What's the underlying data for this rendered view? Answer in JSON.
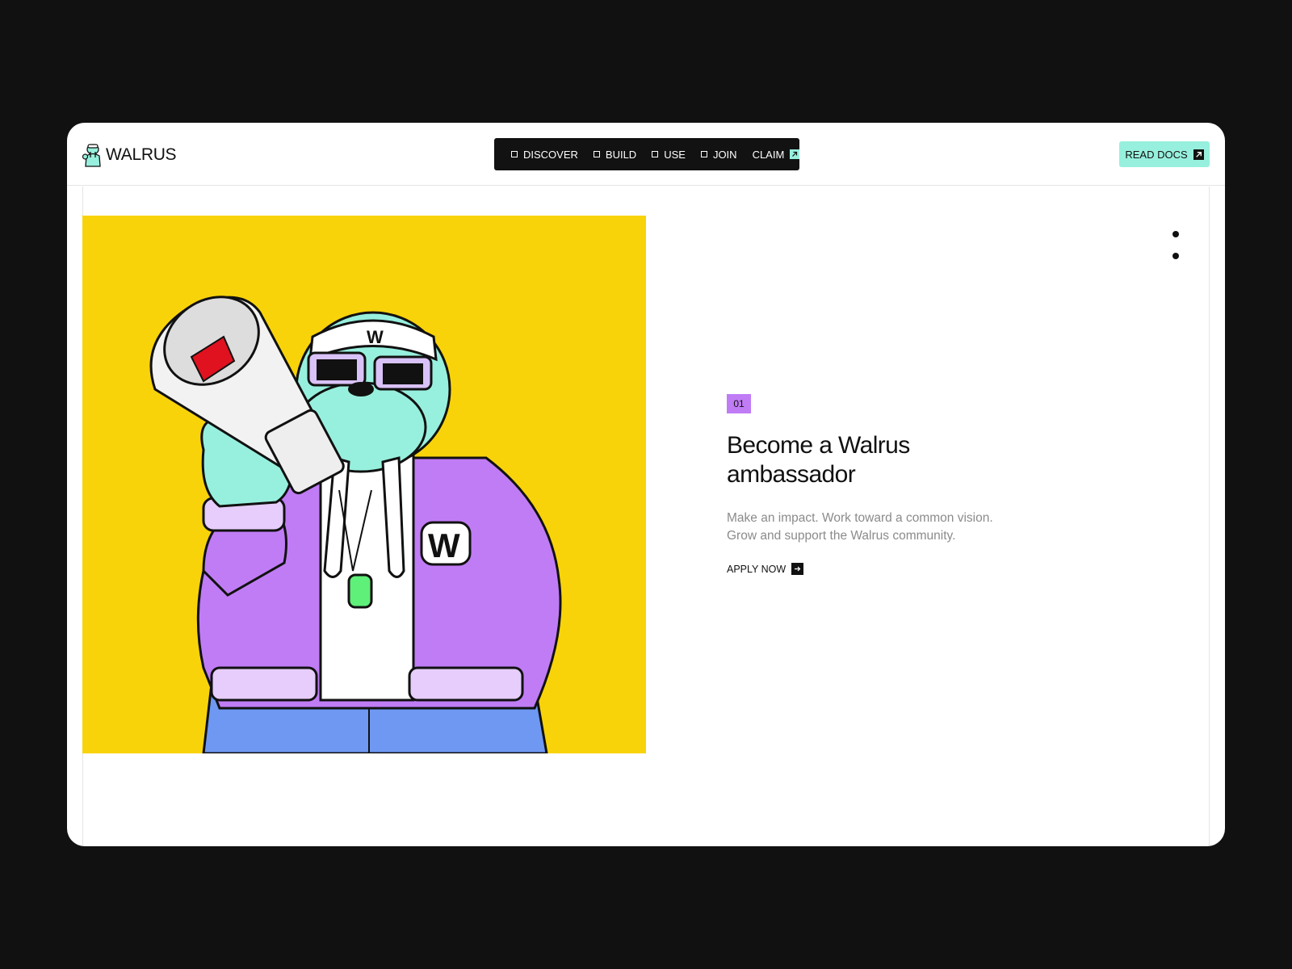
{
  "header": {
    "logo_text": "WALRUS",
    "logo_icon": "walrus-mascot-icon"
  },
  "nav": {
    "items": [
      {
        "label": "DISCOVER",
        "icon": "square-icon"
      },
      {
        "label": "BUILD",
        "icon": "square-icon"
      },
      {
        "label": "USE",
        "icon": "square-icon"
      },
      {
        "label": "JOIN",
        "icon": "square-icon"
      },
      {
        "label": "CLAIM",
        "icon": "external-arrow-icon"
      }
    ]
  },
  "read_docs": {
    "label": "READ DOCS",
    "icon": "external-arrow-icon"
  },
  "slide": {
    "number": "01",
    "heading_line1": "Become a Walrus",
    "heading_line2": "ambassador",
    "desc_line1": "Make an impact. Work toward a common vision.",
    "desc_line2": "Grow and support the Walrus community.",
    "cta_label": "APPLY NOW",
    "cta_icon": "arrow-right-icon"
  },
  "colors": {
    "background": "#111111",
    "accent_mint": "#97f0dd",
    "illustration_yellow": "#f9d30a",
    "badge_purple": "#c07cf5",
    "text_dark": "#111111",
    "text_muted": "#8b8b8b"
  }
}
